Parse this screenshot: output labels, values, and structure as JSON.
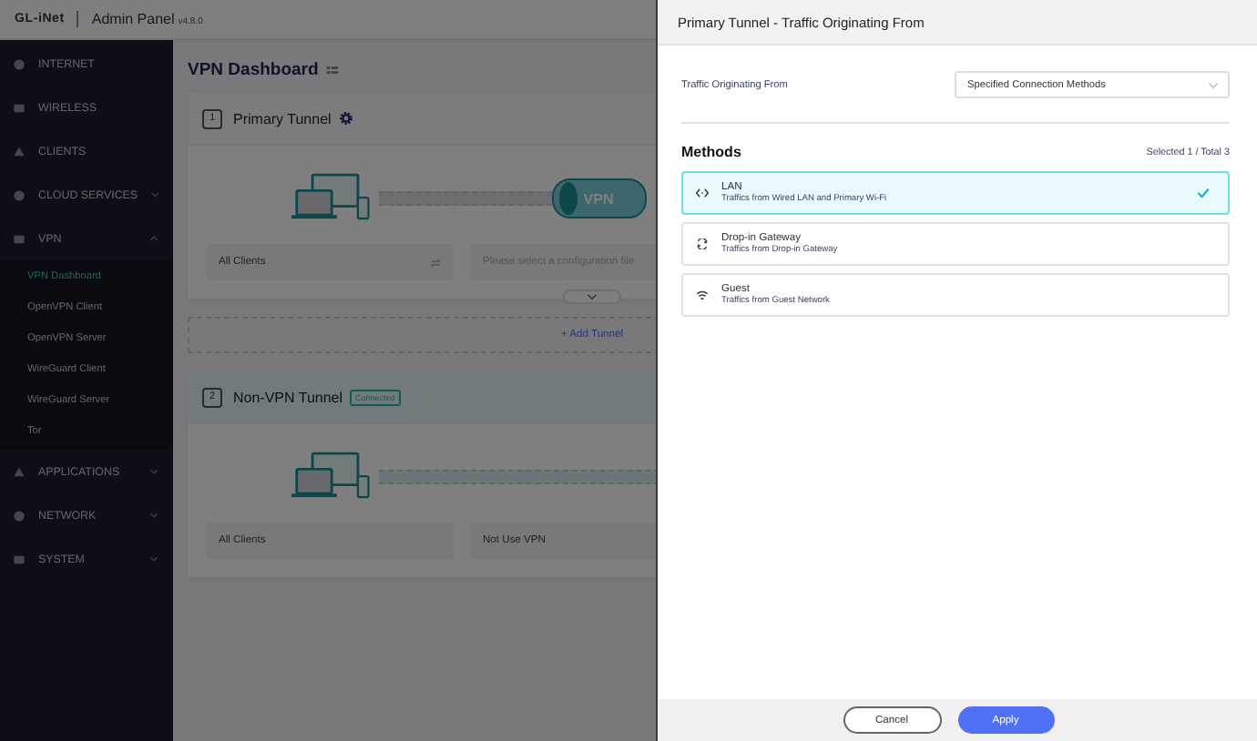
{
  "header": {
    "logo": "GL-iNet",
    "title": "Admin Panel",
    "version": "v4.8.0"
  },
  "sidebar": {
    "items": [
      {
        "label": "INTERNET",
        "kind": "link"
      },
      {
        "label": "WIRELESS",
        "kind": "link"
      },
      {
        "label": "CLIENTS",
        "kind": "link"
      },
      {
        "label": "CLOUD SERVICES",
        "kind": "group",
        "expanded": false
      },
      {
        "label": "VPN",
        "kind": "group",
        "expanded": true,
        "children": [
          {
            "label": "VPN Dashboard",
            "selected": true
          },
          {
            "label": "OpenVPN Client",
            "selected": false
          },
          {
            "label": "OpenVPN Server",
            "selected": false
          },
          {
            "label": "WireGuard Client",
            "selected": false
          },
          {
            "label": "WireGuard Server",
            "selected": false
          },
          {
            "label": "Tor",
            "selected": false
          }
        ]
      },
      {
        "label": "APPLICATIONS",
        "kind": "group",
        "expanded": false
      },
      {
        "label": "NETWORK",
        "kind": "group",
        "expanded": false
      },
      {
        "label": "SYSTEM",
        "kind": "group",
        "expanded": false
      }
    ]
  },
  "main": {
    "title": "VPN Dashboard",
    "tunnels": [
      {
        "number": "1",
        "name": "Primary Tunnel",
        "connected": false,
        "vpn_label": "VPN",
        "source": "All Clients",
        "target_placeholder": "Please select a configuration file"
      },
      {
        "number": "2",
        "name": "Non-VPN Tunnel",
        "connected": true,
        "badge": "Connected",
        "source": "All Clients",
        "target": "Not Use VPN"
      }
    ],
    "add_tunnel": "+ Add Tunnel"
  },
  "drawer": {
    "title": "Primary Tunnel - Traffic Originating From",
    "field_label": "Traffic Originating From",
    "field_value": "Specified Connection Methods",
    "methods_heading": "Methods",
    "methods_count": "Selected 1 / Total 3",
    "methods": [
      {
        "name": "LAN",
        "description": "Traffics from Wired LAN and Primary Wi-Fi",
        "selected": true
      },
      {
        "name": "Drop-in Gateway",
        "description": "Traffics from Drop-in Gateway",
        "selected": false
      },
      {
        "name": "Guest",
        "description": "Traffics from Guest Network",
        "selected": false
      }
    ],
    "buttons": [
      {
        "label": "Cancel",
        "kind": "secondary"
      },
      {
        "label": "Apply",
        "kind": "primary"
      }
    ]
  }
}
